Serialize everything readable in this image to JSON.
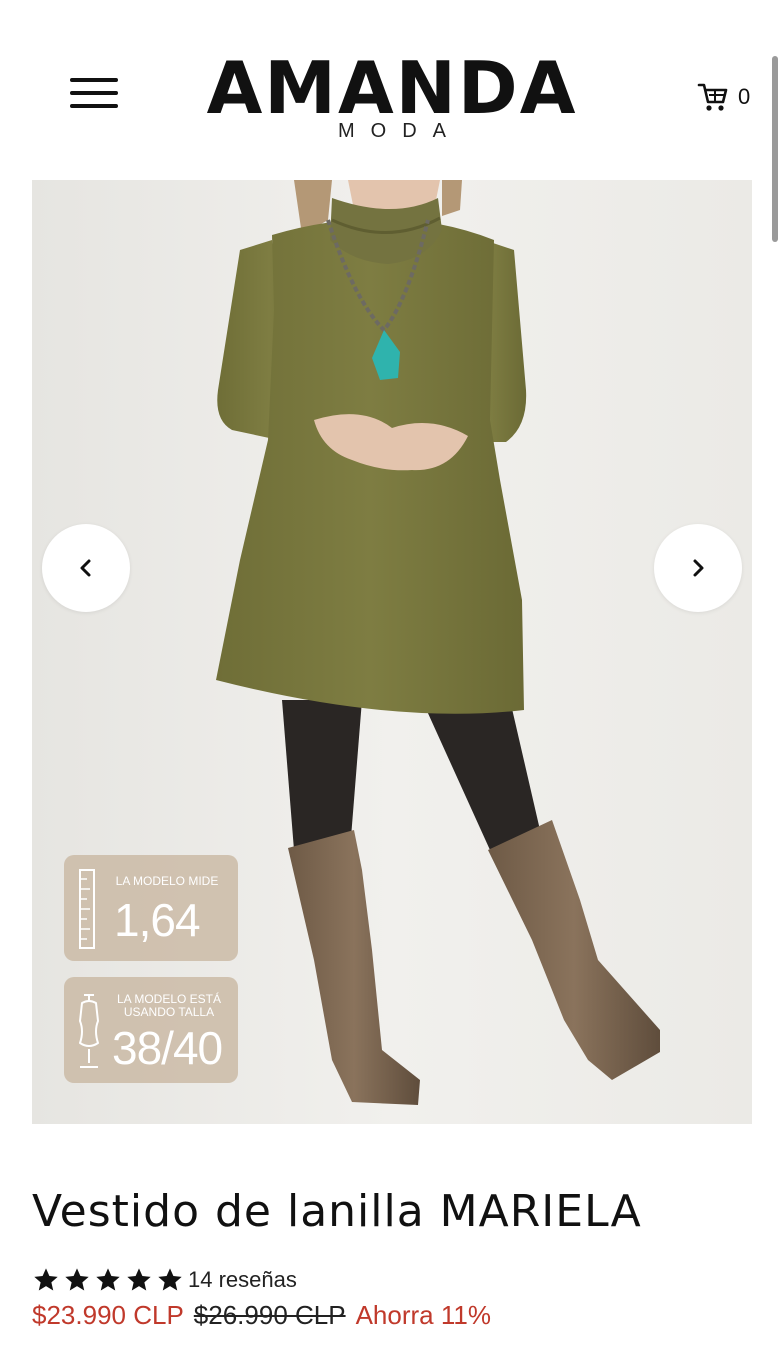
{
  "header": {
    "logo_main": "AMANDA",
    "logo_sub": "MODA",
    "cart_count": "0"
  },
  "gallery": {
    "badge_height_label": "LA MODELO MIDE",
    "badge_height_value": "1,64",
    "badge_size_label": "LA MODELO ESTÁ USANDO TALLA",
    "badge_size_value": "38/40"
  },
  "product": {
    "title": "Vestido de lanilla MARIELA",
    "rating_stars": 5,
    "reviews": "14 reseñas",
    "price_sale": "$23.990 CLP",
    "price_old": "$26.990 CLP",
    "savings": "Ahorra 11%"
  },
  "colors": {
    "sale": "#c0392b",
    "dress": "#7b7a3e",
    "badge": "#c8b6a0"
  },
  "icons": {
    "menu": "hamburger-icon",
    "cart": "cart-icon",
    "prev": "chevron-left-icon",
    "next": "chevron-right-icon",
    "star": "star-icon"
  }
}
